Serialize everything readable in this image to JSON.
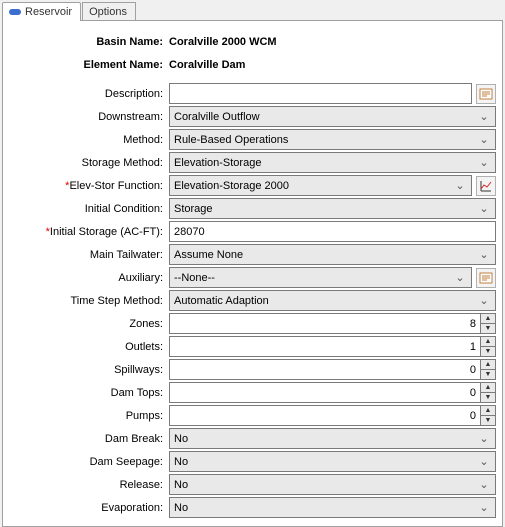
{
  "tabs": {
    "reservoir": "Reservoir",
    "options": "Options"
  },
  "header": {
    "basin_label": "Basin Name:",
    "basin_value": "Coralville 2000 WCM",
    "element_label": "Element Name:",
    "element_value": "Coralville Dam"
  },
  "fields": {
    "description": {
      "label": "Description:",
      "value": ""
    },
    "downstream": {
      "label": "Downstream:",
      "value": "Coralville Outflow"
    },
    "method": {
      "label": "Method:",
      "value": "Rule-Based Operations"
    },
    "storage_method": {
      "label": "Storage Method:",
      "value": "Elevation-Storage"
    },
    "elev_stor_function": {
      "label": "Elev-Stor Function:",
      "value": "Elevation-Storage 2000"
    },
    "initial_condition": {
      "label": "Initial Condition:",
      "value": "Storage"
    },
    "initial_storage": {
      "label": "Initial Storage (AC-FT):",
      "value": "28070"
    },
    "main_tailwater": {
      "label": "Main Tailwater:",
      "value": "Assume None"
    },
    "auxiliary": {
      "label": "Auxiliary:",
      "value": "--None--"
    },
    "time_step_method": {
      "label": "Time Step Method:",
      "value": "Automatic Adaption"
    },
    "zones": {
      "label": "Zones:",
      "value": "8"
    },
    "outlets": {
      "label": "Outlets:",
      "value": "1"
    },
    "spillways": {
      "label": "Spillways:",
      "value": "0"
    },
    "dam_tops": {
      "label": "Dam Tops:",
      "value": "0"
    },
    "pumps": {
      "label": "Pumps:",
      "value": "0"
    },
    "dam_break": {
      "label": "Dam Break:",
      "value": "No"
    },
    "dam_seepage": {
      "label": "Dam Seepage:",
      "value": "No"
    },
    "release": {
      "label": "Release:",
      "value": "No"
    },
    "evaporation": {
      "label": "Evaporation:",
      "value": "No"
    }
  }
}
